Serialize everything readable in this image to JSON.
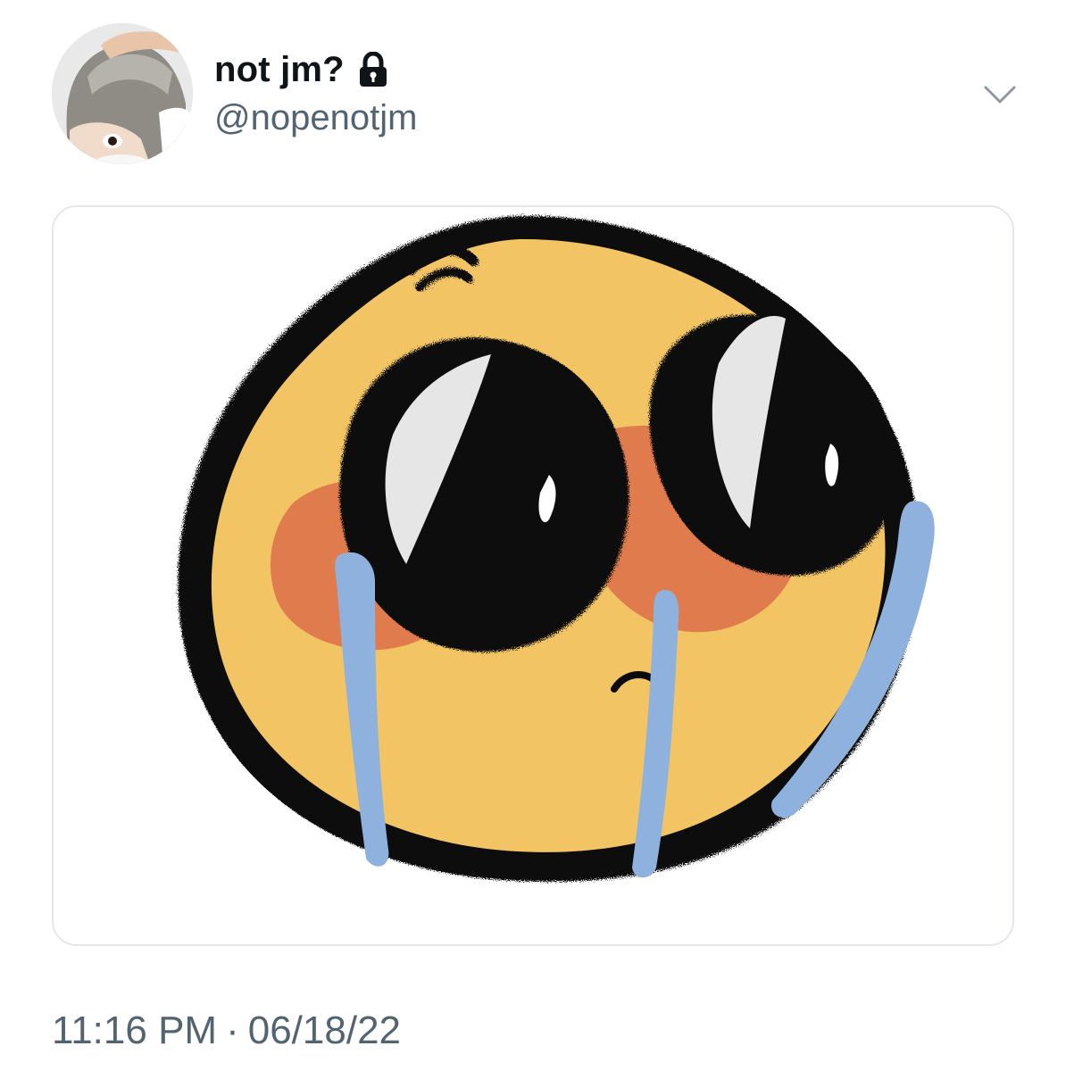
{
  "tweet": {
    "author": {
      "display_name": "not jm?",
      "handle": "@nopenotjm",
      "protected_icon": "lock-icon",
      "avatar_alt": "profile photo"
    },
    "more_icon": "chevron-down-icon",
    "media": {
      "kind": "image",
      "subject": "crying-emoji-drawing",
      "colors": {
        "face": "#f2c464",
        "outline": "#0b0b0b",
        "blush": "#e07b4d",
        "tears": "#8fb1de"
      }
    },
    "time": "11:16 PM",
    "separator": "·",
    "date": "06/18/22"
  },
  "colors": {
    "text_primary": "#0f1419",
    "text_secondary": "#536471",
    "border": "#e3e6ea"
  }
}
